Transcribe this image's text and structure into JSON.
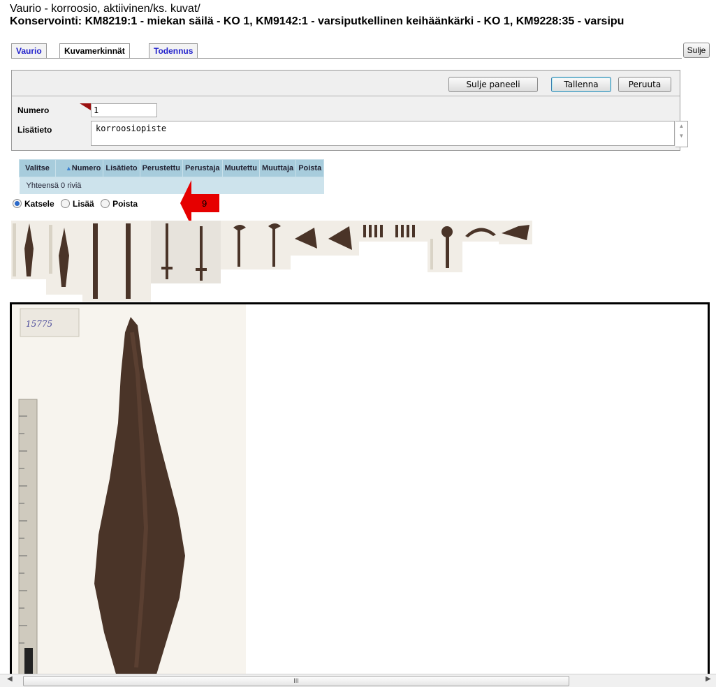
{
  "header": {
    "line1_prefix": "Vaurio",
    "line1_rest": " - korroosio, aktiivinen/ks. kuvat/",
    "line2": "Konservointi: KM8219:1 - miekan säilä - KO 1, KM9142:1 - varsiputkellinen keihäänkärki - KO 1, KM9228:35 - varsipu"
  },
  "tabs": [
    {
      "label": "Vaurio",
      "active": false
    },
    {
      "label": "Kuvamerkinnät",
      "active": true
    },
    {
      "label": "Todennus",
      "active": false
    }
  ],
  "close_label": "Sulje",
  "panel": {
    "close_panel_label": "Sulje paneeli",
    "save_label": "Tallenna",
    "cancel_label": "Peruuta",
    "numero_label": "Numero",
    "numero_value": "1",
    "lisatieto_label": "Lisätieto",
    "lisatieto_value": "korroosiopiste"
  },
  "grid": {
    "columns": [
      "Valitse",
      "Numero",
      "Lisätieto",
      "Perustettu",
      "Perustaja",
      "Muutettu",
      "Muuttaja",
      "Poista"
    ],
    "sort_indicator": "▲",
    "footer": "Yhteensä 0 riviä"
  },
  "modes": {
    "view": "Katsele",
    "add": "Lisää",
    "delete": "Poista",
    "selected": "view"
  },
  "annotation_marker": "9",
  "photo_label": "15775",
  "scrollbar_grip": "III",
  "colors": {
    "tab_link": "#2222cc",
    "grid_header": "#a7ccdc",
    "grid_row": "#cde3ec",
    "marker": "#e60000",
    "rust": "#4a3428"
  }
}
